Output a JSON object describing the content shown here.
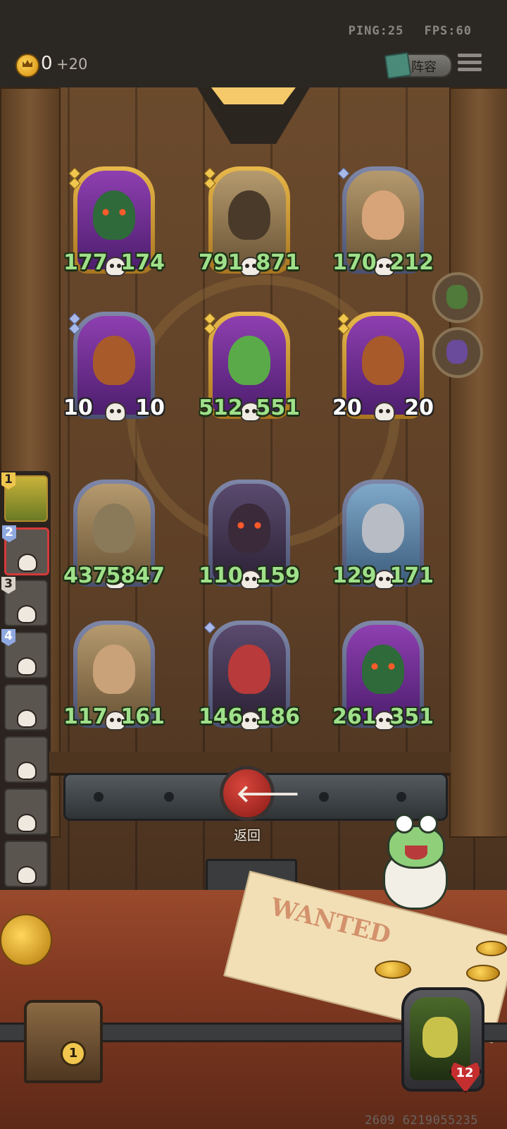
{
  "status": {
    "ping": "PING:25",
    "fps": "FPS:60"
  },
  "gold": {
    "value": "0",
    "income": "+20"
  },
  "header": {
    "lineup_label": "阵容"
  },
  "board": {
    "opponent_row1": [
      {
        "name": "tentacle-shadow",
        "attack": "177",
        "health": "174",
        "tier": "gold",
        "stars": 2
      },
      {
        "name": "grinning-tree",
        "attack": "791",
        "health": "871",
        "tier": "gold",
        "stars": 2
      },
      {
        "name": "leaf-mask",
        "attack": "170",
        "health": "212",
        "tier": "silver",
        "stars": 1
      }
    ],
    "opponent_row2": [
      {
        "name": "pumpkin-beast",
        "attack": "10",
        "health": "10",
        "tier": "silver",
        "stars": 2
      },
      {
        "name": "cactus",
        "attack": "512",
        "health": "551",
        "tier": "gold",
        "stars": 2
      },
      {
        "name": "pumpkin-beast",
        "attack": "20",
        "health": "20",
        "tier": "gold",
        "stars": 2
      }
    ],
    "player_row1": [
      {
        "name": "robot-golem",
        "attack": "4375",
        "health": "5847",
        "tier": "silver",
        "stars": 0
      },
      {
        "name": "horned-beast",
        "attack": "110",
        "health": "159",
        "tier": "silver",
        "stars": 0
      },
      {
        "name": "armored-knight",
        "attack": "129",
        "health": "171",
        "tier": "silver",
        "stars": 0
      }
    ],
    "player_row2": [
      {
        "name": "old-scholar",
        "attack": "117",
        "health": "161",
        "tier": "silver",
        "stars": 0
      },
      {
        "name": "red-haired-warrior",
        "attack": "146",
        "health": "186",
        "tier": "silver",
        "stars": 1
      },
      {
        "name": "tentacle-shadow",
        "attack": "261",
        "health": "351",
        "tier": "silver",
        "stars": 0
      }
    ]
  },
  "roster": {
    "slots": [
      {
        "rank": "1",
        "state": "active"
      },
      {
        "rank": "2",
        "state": "selected"
      },
      {
        "rank": "3",
        "state": "dead"
      },
      {
        "rank": "4",
        "state": "dead"
      },
      {
        "rank": "",
        "state": "dead"
      },
      {
        "rank": "",
        "state": "dead"
      },
      {
        "rank": "",
        "state": "dead"
      },
      {
        "rank": "",
        "state": "dead"
      }
    ]
  },
  "controls": {
    "back_label": "返回",
    "back_arrow": "🡐"
  },
  "chest": {
    "count": "1"
  },
  "player_hero": {
    "health": "12"
  },
  "footer": {
    "seed": "2609 6219055235"
  },
  "colors": {
    "stat_green": "#9fe08a",
    "back_red": "#d8463c",
    "gold": "#f0c64e"
  }
}
